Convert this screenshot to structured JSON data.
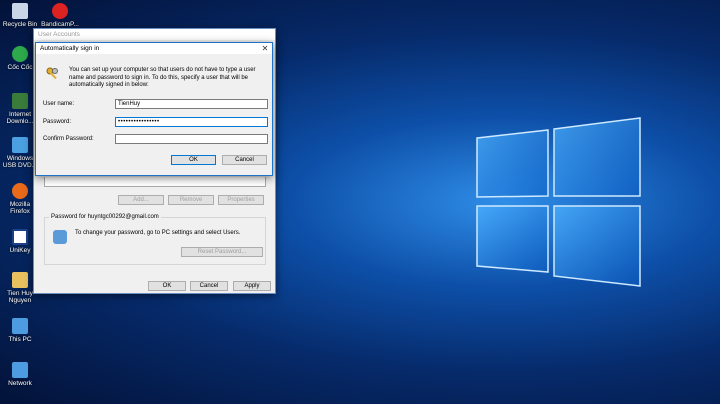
{
  "desktop": {
    "icons": [
      {
        "label": "Recycle Bin"
      },
      {
        "label": "BandicamP..."
      },
      {
        "label": "Cốc Cốc"
      },
      {
        "label": "Internet Downlo..."
      },
      {
        "label": "Windows USB DVD..."
      },
      {
        "label": "Mozilla Firefox"
      },
      {
        "label": "UniKey"
      },
      {
        "label": "Tien Huy Nguyen"
      },
      {
        "label": "This PC"
      },
      {
        "label": "Network"
      }
    ]
  },
  "user_accounts": {
    "title": "User Accounts",
    "buttons": {
      "add": "Add...",
      "remove": "Remove",
      "properties": "Properties"
    },
    "password_group": {
      "title": "Password for huyntgc00292@gmail.com",
      "text": "To change your password, go to PC settings and select Users.",
      "reset": "Reset Password..."
    },
    "footer": {
      "ok": "OK",
      "cancel": "Cancel",
      "apply": "Apply"
    }
  },
  "auto_signin": {
    "title": "Automatically sign in",
    "description": "You can set up your computer so that users do not have to type a user name and password to sign in. To do this, specify a user that will be automatically signed in below:",
    "username_label": "User name:",
    "username_value": "TienHuy",
    "password_label": "Password:",
    "password_value": "••••••••••••••••",
    "confirm_label": "Confirm Password:",
    "confirm_value": "",
    "ok": "OK",
    "cancel": "Cancel"
  }
}
